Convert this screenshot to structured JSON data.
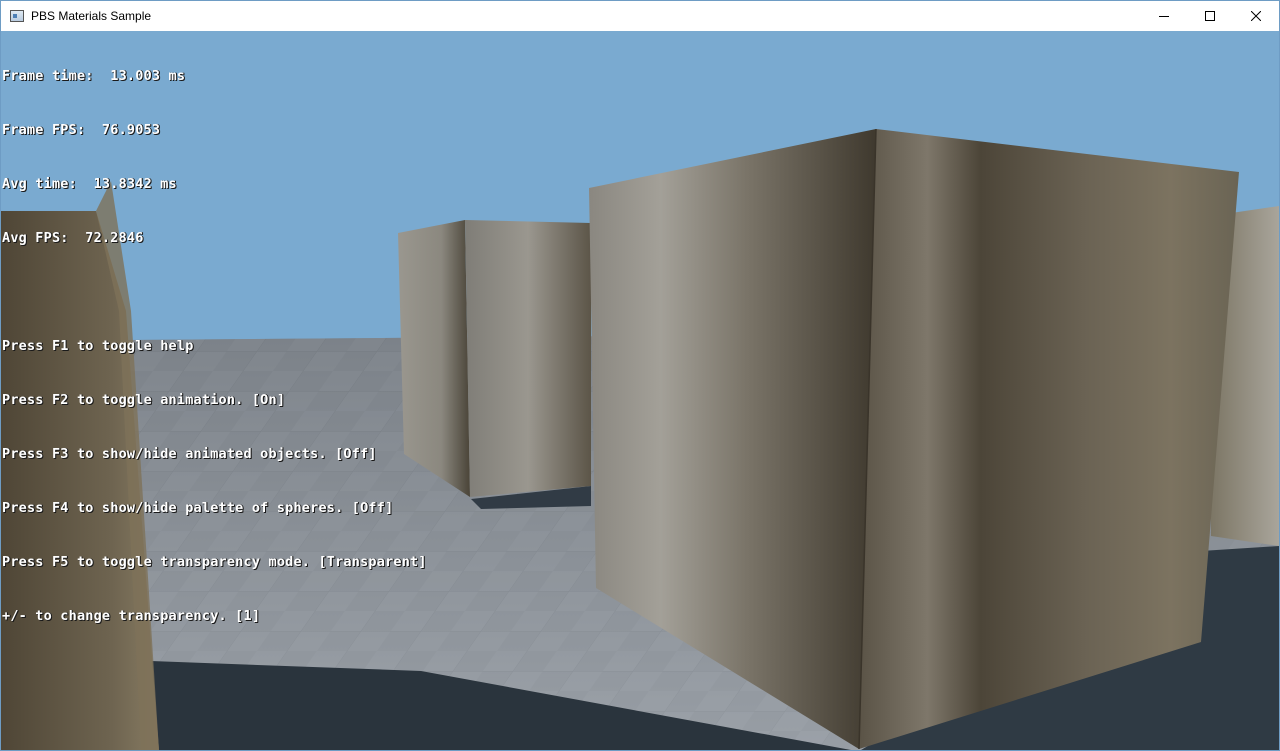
{
  "window": {
    "title": "PBS Materials Sample",
    "icon": "app-window-icon",
    "controls": {
      "minimize": "minimize-icon",
      "maximize": "maximize-icon",
      "close": "close-icon"
    }
  },
  "stats": {
    "frame_time": "Frame time:  13.003 ms",
    "frame_fps": "Frame FPS:  76.9053",
    "avg_time": "Avg time:  13.8342 ms",
    "avg_fps": "Avg FPS:  72.2846"
  },
  "help": {
    "f1": "Press F1 to toggle help",
    "f2": "Press F2 to toggle animation. [On]",
    "f3": "Press F3 to show/hide animated objects. [Off]",
    "f4": "Press F4 to show/hide palette of spheres. [Off]",
    "f5": "Press F5 to toggle transparency mode. [Transparent]",
    "transparency": "+/- to change transparency. [1]"
  },
  "colors": {
    "sky": "#7aaad0",
    "floor": "#8a9098",
    "floor_shadow": "#2f3a44",
    "cube": "#6a6356"
  }
}
